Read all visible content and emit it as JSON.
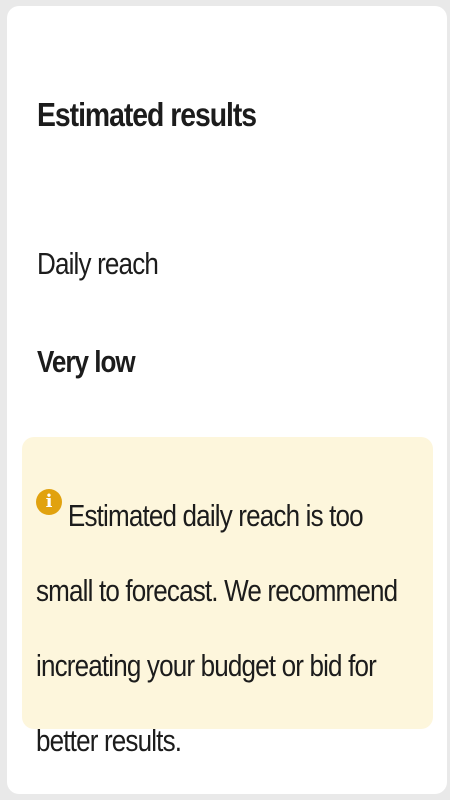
{
  "results": {
    "title": "Estimated results",
    "metric_label": "Daily reach",
    "metric_value": "Very low"
  },
  "notice": {
    "icon": "info-icon",
    "icon_glyph": "i",
    "icon_color": "#e1a20f",
    "background_color": "#fdf6dc",
    "text": "Estimated daily reach is too small to forecast. We recommend increating your budget or bid for better results."
  }
}
